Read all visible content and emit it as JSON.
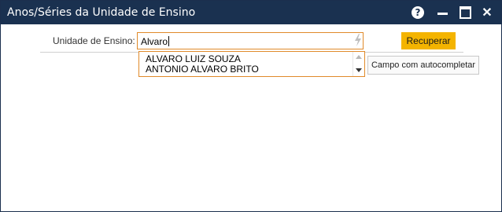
{
  "window": {
    "title": "Anos/Séries da Unidade de Ensino",
    "controls": {
      "help": "?",
      "close": "✕"
    }
  },
  "form": {
    "label": "Unidade de Ensino:",
    "input_value": "Alvaro",
    "button_label": "Recuperar",
    "tooltip": "Campo com autocompletar"
  },
  "autocomplete": {
    "items": [
      "ALVARO LUIZ SOUZA",
      "ANTONIO ALVARO BRITO"
    ]
  },
  "colors": {
    "titlebar": "#1a3150",
    "button": "#f4b400",
    "input_border": "#e08a2a"
  },
  "icons": [
    "help-icon",
    "minimize-icon",
    "maximize-icon",
    "close-icon",
    "lightning-icon",
    "scroll-up-icon",
    "scroll-down-icon"
  ]
}
